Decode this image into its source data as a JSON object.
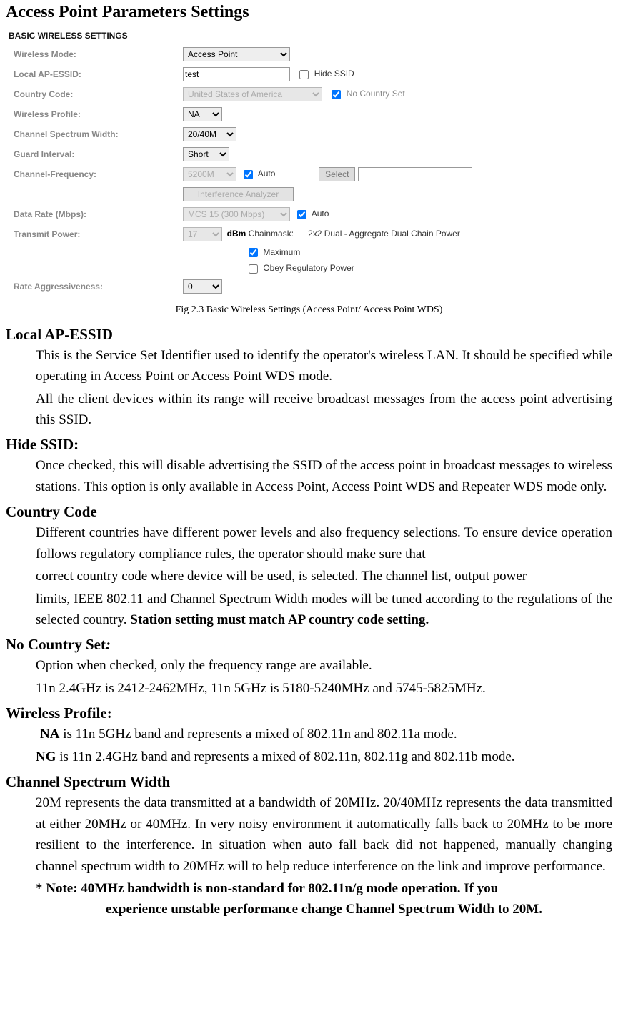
{
  "title": "Access Point Parameters Settings",
  "panel": {
    "heading": "BASIC WIRELESS SETTINGS",
    "rows": {
      "wirelessMode": {
        "label": "Wireless Mode:",
        "value": "Access Point"
      },
      "localApEssid": {
        "label": "Local AP-ESSID:",
        "value": "test",
        "hideSsid": "Hide SSID"
      },
      "countryCode": {
        "label": "Country Code:",
        "value": "United States of America",
        "noCountry": "No Country Set"
      },
      "wirelessProfile": {
        "label": "Wireless Profile:",
        "value": "NA"
      },
      "channelSpectrum": {
        "label": "Channel Spectrum Width:",
        "value": "20/40M"
      },
      "guardInterval": {
        "label": "Guard Interval:",
        "value": "Short"
      },
      "channelFreq": {
        "label": "Channel-Frequency:",
        "value": "5200M",
        "auto": "Auto",
        "selectBtn": "Select",
        "analyzer": "Interference Analyzer"
      },
      "dataRate": {
        "label": "Data Rate (Mbps):",
        "value": "MCS 15 (300 Mbps)",
        "auto": "Auto"
      },
      "txPower": {
        "label": "Transmit Power:",
        "value": "17",
        "dbm": "dBm",
        "chainLabel": "Chainmask:",
        "chainValue": "2x2 Dual - Aggregate Dual Chain Power",
        "maximum": "Maximum",
        "obey": "Obey Regulatory Power"
      },
      "rateAggr": {
        "label": "Rate Aggressiveness:",
        "value": "0"
      }
    }
  },
  "caption": "Fig 2.3 Basic Wireless Settings (Access Point/ Access Point WDS)",
  "sections": {
    "localApEssid": {
      "title": "Local AP-ESSID",
      "p1": "This is the Service Set Identifier used to identify the operator's wireless LAN. It should be specified while operating in Access Point or Access Point WDS mode.",
      "p2": "All the client devices within its range will receive broadcast messages from the access   point advertising this SSID."
    },
    "hideSsid": {
      "title": "Hide SSID:",
      "p1": "Once checked, this will disable advertising the SSID of the access point in broadcast messages to wireless stations. This option is only available in Access Point, Access Point WDS and Repeater WDS mode only."
    },
    "countryCode": {
      "title": "Country Code",
      "p1a": "Different countries have different power levels and also frequency selections. To ensure device operation follows regulatory compliance rules, the operator should make sure  that",
      "p1b": "correct country code where device will be used, is selected. The channel list, output  power",
      "p1c_prefix": "limits, IEEE 802.11 and Channel Spectrum Width modes will be tuned according to the regulations of the selected country. ",
      "p1c_bold": "Station setting must match AP country code setting."
    },
    "noCountrySet": {
      "title_prefix": "No Country Set",
      "title_colon": ":",
      "p1": "Option when checked, only the frequency range are available.",
      "p2": "11n 2.4GHz is 2412-2462MHz, 11n 5GHz is 5180-5240MHz and 5745-5825MHz."
    },
    "wirelessProfile": {
      "title": "Wireless Profile:",
      "na_bold": "NA",
      "na_rest": " is 11n 5GHz band and represents a mixed of 802.11n and 802.11a mode.",
      "ng_bold": "NG",
      "ng_rest": " is 11n 2.4GHz band and represents a mixed of 802.11n, 802.11g and 802.11b mode."
    },
    "channelSpectrum": {
      "title": "Channel Spectrum Width",
      "p1": "20M represents the data transmitted at a bandwidth of 20MHz. 20/40MHz represents the data transmitted at either 20MHz or 40MHz. In very noisy environment it automatically falls back to 20MHz to be more resilient to the interference. In situation when auto fall back did not happened, manually changing channel spectrum width to 20MHz will to help reduce interference on the link and improve performance.",
      "note1": "* Note: 40MHz bandwidth is non-standard for 802.11n/g mode operation. If you",
      "note2": "experience unstable performance change Channel Spectrum Width to 20M."
    }
  }
}
